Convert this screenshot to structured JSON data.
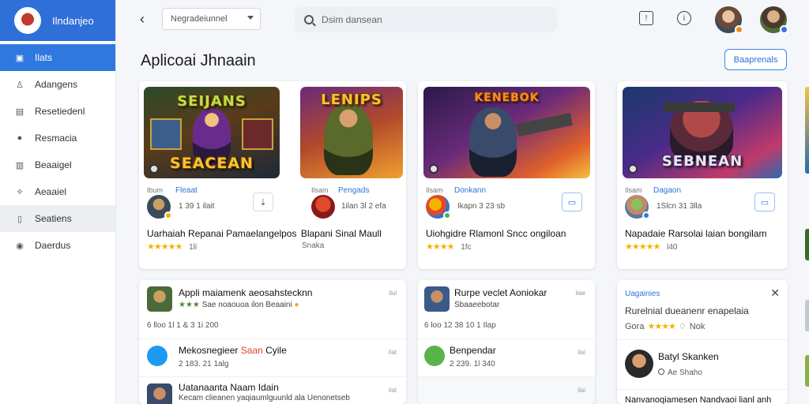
{
  "app": {
    "name": "Ilndanjeo"
  },
  "sidebar": {
    "items": [
      {
        "label": "Ilats",
        "icon": "store-icon",
        "glyph": "▣",
        "state": "active"
      },
      {
        "label": "Adangens",
        "icon": "user-icon",
        "glyph": "♙",
        "state": ""
      },
      {
        "label": "Resetiedenl",
        "icon": "window-icon",
        "glyph": "▤",
        "state": ""
      },
      {
        "label": "Resmacia",
        "icon": "circle-icon",
        "glyph": "●",
        "state": ""
      },
      {
        "label": "Beaaigel",
        "icon": "document-icon",
        "glyph": "▥",
        "state": ""
      },
      {
        "label": "Aeaaiel",
        "icon": "share-icon",
        "glyph": "⟡",
        "state": ""
      },
      {
        "label": "Seatiens",
        "icon": "book-icon",
        "glyph": "▯",
        "state": "hover"
      },
      {
        "label": "Daerdus",
        "icon": "shield-icon",
        "glyph": "◉",
        "state": ""
      }
    ]
  },
  "topbar": {
    "dropdown_value": "Negradeiunnel",
    "search_placeholder": "Dsim dansean"
  },
  "header": {
    "title": "Aplicoai Jhnaain",
    "button_label": "Baaprenals"
  },
  "cards": [
    {
      "art_title_top": "SEIJANS",
      "art_title_bottom": "SEACEAN",
      "small_label": "Ibum",
      "tag": "Fleaat",
      "stats": "1 39   1 ilait",
      "action_glyph": "⇣",
      "title": "Uarhaiah Repanai Pamaelangelpos",
      "rating_stars": "★★★★★",
      "rating_count": "1li"
    },
    {
      "art_title_top": "LENIPS",
      "art_title_bottom": "",
      "small_label": "Ilsam",
      "tag": "Pengads",
      "stats": "1ilan  3l 2 efa",
      "action_glyph": "",
      "title": "Blapani Sinal Maull",
      "rating_stars": "",
      "rating_count": "Snaka"
    },
    {
      "art_title_top": "KENEBOK",
      "art_title_bottom": "",
      "small_label": "Ilsam",
      "tag": "Donkann",
      "stats": "Ikapn 3  23 sb",
      "action_glyph": "☐",
      "title": "Uiohgidre Rlamonl Sncc ongiloan",
      "rating_stars": "★★★★",
      "rating_count": "1fc"
    },
    {
      "art_title_top": "",
      "art_title_bottom": "SEBNEAN",
      "small_label": "Ilsam",
      "tag": "Dagaon",
      "stats": "1Slcn 31 3lla",
      "action_glyph": "☐",
      "title": "Napadaie Rarsolai laian bongilam",
      "rating_stars": "★★★★★",
      "rating_count": "l40"
    }
  ],
  "panel_left": [
    {
      "title": "Appli maiamenk aeosahstecknn",
      "line2": "Sae noaouoa ilon Beaaini",
      "meta": "6 lloo  1l 1  & 3 1i 200",
      "tiny": "ilui"
    },
    {
      "title": "Mekosnegieer Saan Cyile",
      "highlight": "Saan",
      "line2": "2 183.   21   1alg",
      "tiny": "ilat"
    },
    {
      "title": "Uatanaanta Naam Idain",
      "line2": "Kecam clieanen yaqiaumlguunld ala Uenonetseb",
      "tiny": "ilat"
    }
  ],
  "panel_middle": [
    {
      "title": "Rurpe veclet Aoniokar",
      "line2": "Sbaaeebotar",
      "meta": "6 loo   12 38 10 1  Ilap",
      "tiny": "ilae"
    },
    {
      "title": "Benpendar",
      "line2": "2 239.  1l  340",
      "tiny": "ilai"
    },
    {
      "title": "",
      "line2": "",
      "tiny": "ilai"
    }
  ],
  "panel_right": {
    "header": "Uagainies",
    "line1": "Rurelnial dueanenr enapelaia",
    "rating_prefix": "Gora",
    "rating_stars": "★★★★",
    "rating_suffix": "Nok",
    "person_name": "Batyl Skanken",
    "person_sub": "Ae Shaho",
    "bottom_text": "Nanvanoqiamesen Nandvaoi lianl anh"
  },
  "colors": {
    "primary": "#2f78e0",
    "brand_bar": "#2f6fd8",
    "star": "#f5b301",
    "highlight": "#e0442a"
  }
}
